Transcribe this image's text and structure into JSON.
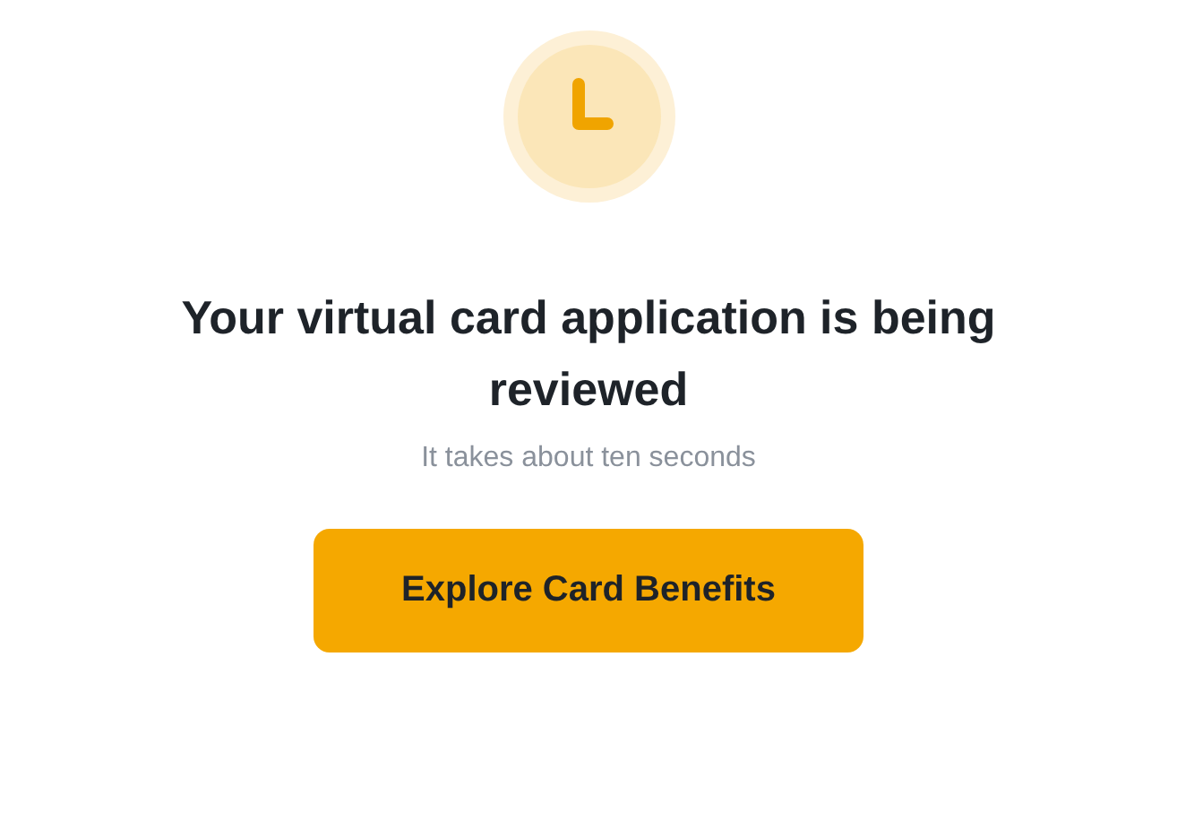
{
  "title": "Your virtual card application is being reviewed",
  "subtitle": "It takes about ten seconds",
  "button": {
    "label": "Explore Card Benefits"
  }
}
